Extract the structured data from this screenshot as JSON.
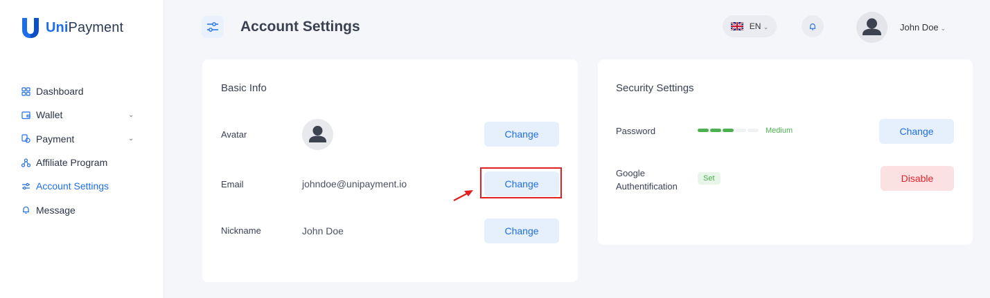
{
  "brand": {
    "name_bold": "Uni",
    "name_rest": "Payment",
    "color": "#1e6ee8"
  },
  "sidebar": {
    "items": [
      {
        "label": "Dashboard",
        "icon": "grid-icon",
        "active": false,
        "has_chevron": false
      },
      {
        "label": "Wallet",
        "icon": "wallet-icon",
        "active": false,
        "has_chevron": true
      },
      {
        "label": "Payment",
        "icon": "payment-icon",
        "active": false,
        "has_chevron": true
      },
      {
        "label": "Affiliate Program",
        "icon": "affiliate-icon",
        "active": false,
        "has_chevron": false
      },
      {
        "label": "Account Settings",
        "icon": "settings-sliders-icon",
        "active": true,
        "has_chevron": false
      },
      {
        "label": "Message",
        "icon": "bell-icon",
        "active": false,
        "has_chevron": false
      }
    ]
  },
  "header": {
    "title": "Account Settings",
    "icon": "settings-sliders-icon",
    "language": "EN",
    "language_flag": "uk-flag-icon",
    "notification_icon": "bell-icon",
    "user_name": "John Doe"
  },
  "basic_info": {
    "title": "Basic Info",
    "avatar_label": "Avatar",
    "email_label": "Email",
    "email_value": "johndoe@unipayment.io",
    "nickname_label": "Nickname",
    "nickname_value": "John Doe",
    "change_label": "Change"
  },
  "security": {
    "title": "Security Settings",
    "password_label": "Password",
    "password_strength": "Medium",
    "password_strength_level": 0.6,
    "google_label_line1": "Google",
    "google_label_line2": "Authentification",
    "google_status": "Set",
    "change_label": "Change",
    "disable_label": "Disable"
  },
  "colors": {
    "accent": "#1e6ee8",
    "danger": "#e3242b",
    "success": "#4caf50",
    "highlight": "#e02020"
  }
}
